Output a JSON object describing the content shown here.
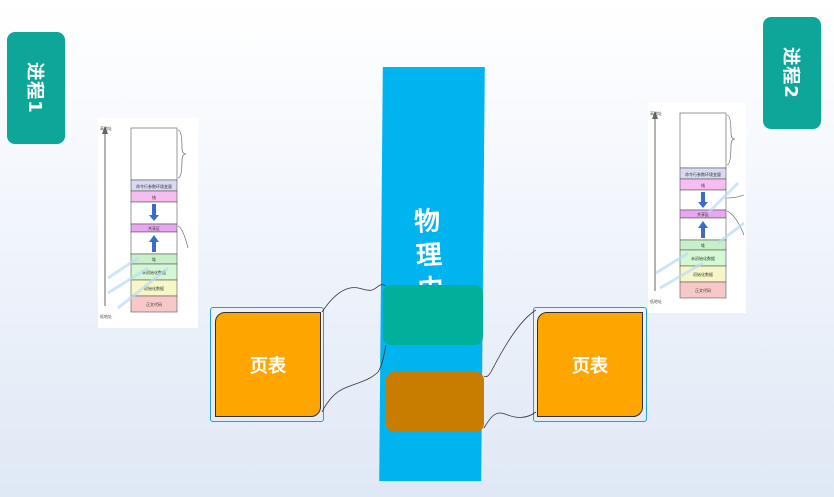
{
  "process1": {
    "title": "进程1"
  },
  "process2": {
    "title": "进程2"
  },
  "physical_memory": {
    "label": "物理内"
  },
  "page_table_1": {
    "label": "页表"
  },
  "page_table_2": {
    "label": "页表"
  },
  "memory_layout": {
    "high_addr": "高地址",
    "low_addr": "低地址",
    "segments": [
      "命令行参数环境变量",
      "栈",
      "共享区",
      "堆",
      "未初始化数据",
      "初始化数据",
      "正文代码"
    ]
  },
  "colors": {
    "tab": "#0fa69a",
    "physical_memory": "#00b4f0",
    "block_green": "#00b09a",
    "block_brown": "#c97d00",
    "page_table": "#ffa500"
  }
}
